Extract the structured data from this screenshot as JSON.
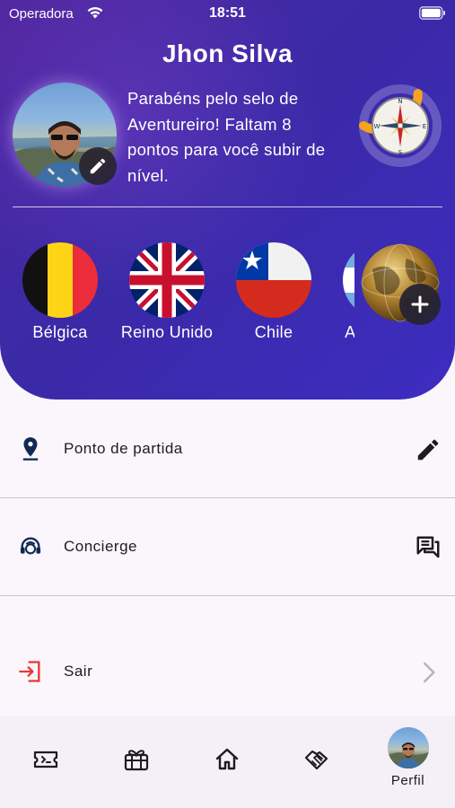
{
  "status_bar": {
    "carrier": "Operadora",
    "time": "18:51"
  },
  "profile": {
    "name": "Jhon Silva",
    "badge_message": "Parabéns pelo selo de Aventureiro! Faltam 8 pontos para você subir de nível.",
    "level_progress": 0.33
  },
  "countries": [
    {
      "name": "Bélgica",
      "icon": "belgium-flag-icon"
    },
    {
      "name": "Reino Unido",
      "icon": "uk-flag-icon"
    },
    {
      "name": "Chile",
      "icon": "chile-flag-icon"
    },
    {
      "name": "Argentina",
      "icon": "argentina-flag-icon"
    }
  ],
  "menu": [
    {
      "label": "Ponto de partida",
      "icon": "location-pin-icon",
      "action_icon": "pencil-icon"
    },
    {
      "label": "Concierge",
      "icon": "headset-icon",
      "action_icon": "chat-icon"
    },
    {
      "label": "Sair",
      "icon": "logout-icon",
      "action_icon": "chevron-right-icon"
    }
  ],
  "bottom_nav": [
    {
      "icon": "ticket-icon"
    },
    {
      "icon": "gift-icon"
    },
    {
      "icon": "home-icon"
    },
    {
      "icon": "handshake-icon"
    },
    {
      "label": "Perfil",
      "icon": "avatar"
    }
  ],
  "colors": {
    "header_gradient_start": "#52279f",
    "header_gradient_end": "#3d2cc0",
    "progress_ring": "#f7a31e",
    "logout_accent": "#e53935",
    "icon_dark": "#102a54"
  }
}
